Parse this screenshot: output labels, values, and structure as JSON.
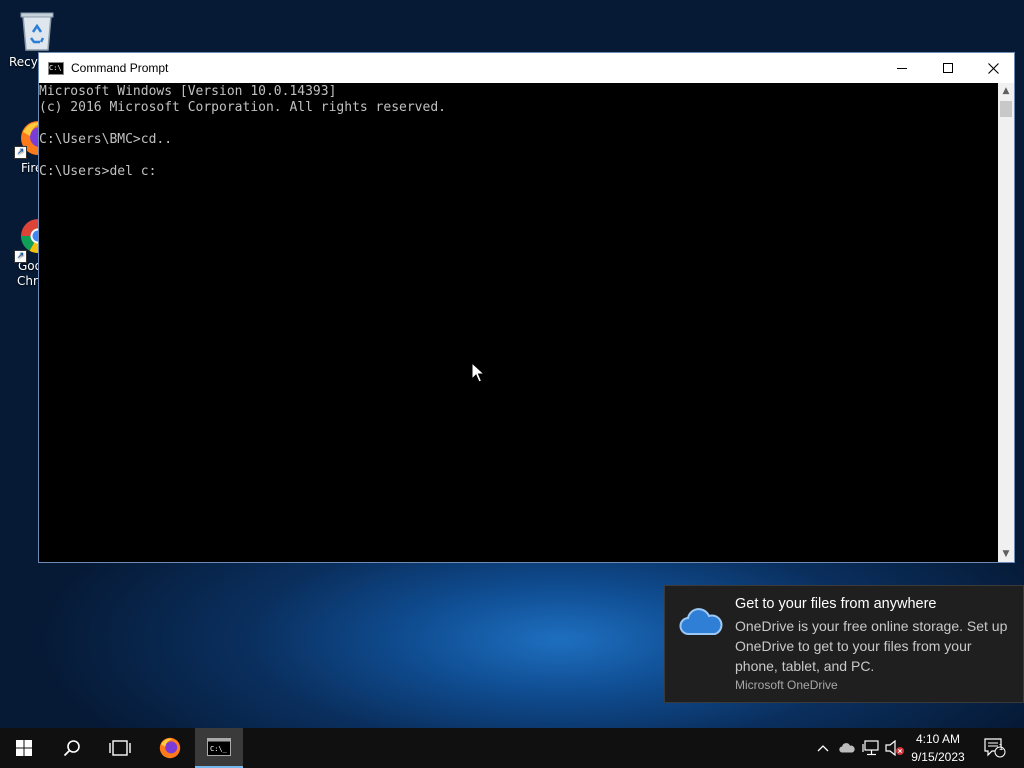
{
  "desktop": {
    "icons": [
      {
        "label": "Recycle Bin",
        "visible_label": "Recyc"
      },
      {
        "label": "Firefox",
        "visible_label": "Fire"
      },
      {
        "label": "Google Chrome",
        "visible_label_1": "Goo",
        "visible_label_2": "Chr"
      }
    ]
  },
  "window": {
    "title": "Command Prompt",
    "console_lines": [
      "Microsoft Windows [Version 10.0.14393]",
      "(c) 2016 Microsoft Corporation. All rights reserved.",
      "",
      "C:\\Users\\BMC>cd..",
      "",
      "C:\\Users>del c:"
    ]
  },
  "notification": {
    "title": "Get to your files from anywhere",
    "body": "OneDrive is your free online storage. Set up OneDrive to get to your files from your phone, tablet, and PC.",
    "source": "Microsoft OneDrive"
  },
  "taskbar": {
    "time": "4:10 AM",
    "date": "9/15/2023",
    "notification_count": "1"
  },
  "colors": {
    "console_bg": "#000000",
    "console_fg": "#c0c0c0",
    "taskbar_bg": "#101010",
    "toast_bg": "#1f1f1f",
    "accent": "#76b9ed"
  }
}
